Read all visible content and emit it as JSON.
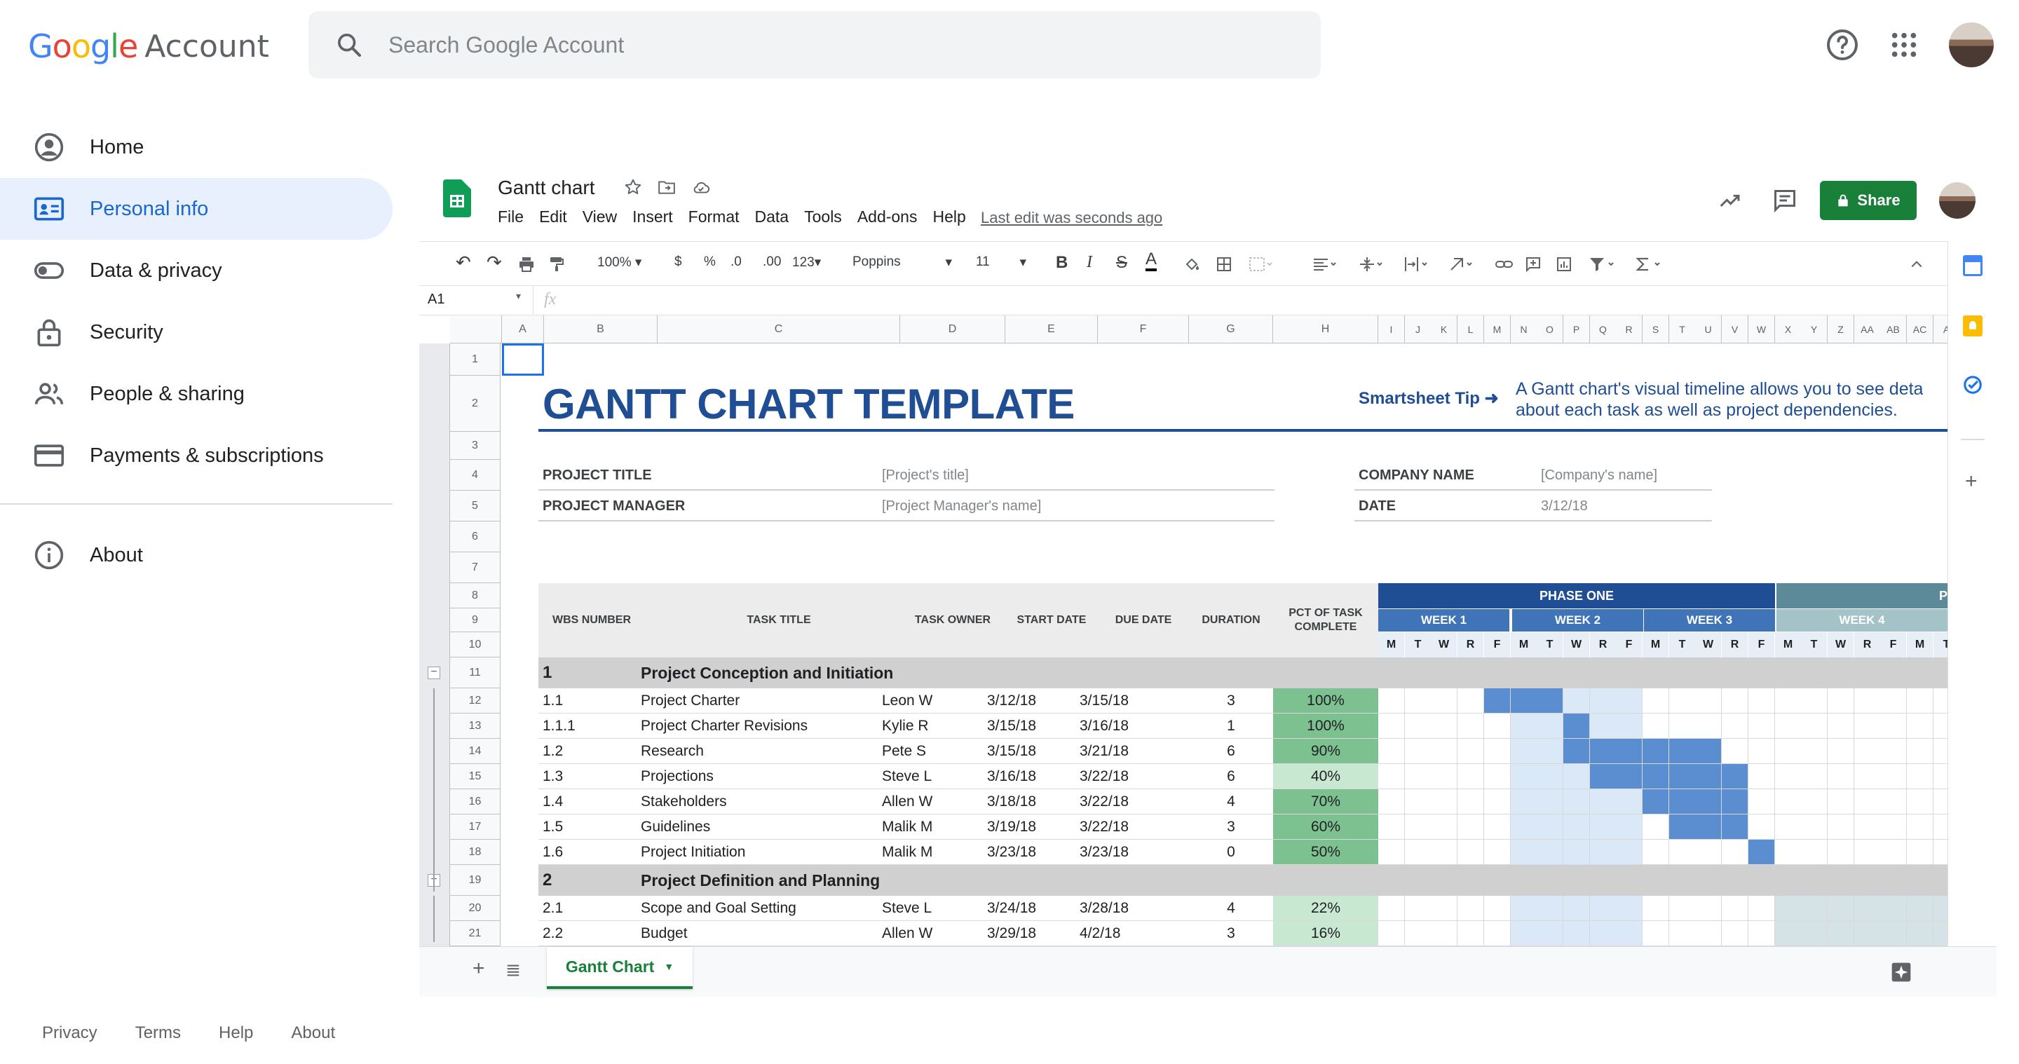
{
  "header": {
    "logo_google": "Google",
    "logo_account": "Account",
    "search_placeholder": "Search Google Account"
  },
  "nav": {
    "items": [
      {
        "label": "Home",
        "icon": "account-circle-icon"
      },
      {
        "label": "Personal info",
        "icon": "id-card-icon",
        "active": true
      },
      {
        "label": "Data & privacy",
        "icon": "toggle-icon"
      },
      {
        "label": "Security",
        "icon": "lock-icon"
      },
      {
        "label": "People & sharing",
        "icon": "people-icon"
      },
      {
        "label": "Payments & subscriptions",
        "icon": "credit-card-icon"
      }
    ],
    "about": "About"
  },
  "footer": {
    "links": [
      "Privacy",
      "Terms",
      "Help",
      "About"
    ]
  },
  "sheet": {
    "title": "Gantt chart",
    "menus": [
      "File",
      "Edit",
      "View",
      "Insert",
      "Format",
      "Data",
      "Tools",
      "Add-ons",
      "Help"
    ],
    "last_edit": "Last edit was seconds ago",
    "share": "Share",
    "toolbar": {
      "zoom": "100%",
      "currency": "$",
      "percent": "%",
      "dec_less": ".0",
      "dec_more": ".00",
      "format": "123",
      "font": "Poppins",
      "size": "11"
    },
    "cell_ref": "A1",
    "fx": "fx",
    "tab": "Gantt Chart",
    "columns": [
      "A",
      "B",
      "C",
      "D",
      "E",
      "F",
      "G",
      "H",
      "I",
      "J",
      "K",
      "L",
      "M",
      "N",
      "O",
      "P",
      "Q",
      "R",
      "S",
      "T",
      "U",
      "V",
      "W",
      "X",
      "Y",
      "Z",
      "AA",
      "AB",
      "AC",
      "A"
    ],
    "rows": [
      "1",
      "2",
      "3",
      "4",
      "5",
      "6",
      "7",
      "8",
      "9",
      "10",
      "11",
      "12",
      "13",
      "14",
      "15",
      "16",
      "17",
      "18",
      "19",
      "20",
      "21"
    ],
    "template_title": "GANTT CHART TEMPLATE",
    "tip_label": "Smartsheet Tip ➜",
    "tip_line1": "A Gantt chart's visual timeline allows you to see deta",
    "tip_line2": "about each task as well as project dependencies.",
    "project_title_label": "PROJECT TITLE",
    "project_title_value": "[Project's title]",
    "project_manager_label": "PROJECT MANAGER",
    "project_manager_value": "[Project Manager's name]",
    "company_label": "COMPANY NAME",
    "company_value": "[Company's name]",
    "date_label": "DATE",
    "date_value": "3/12/18",
    "table_headers": {
      "wbs": "WBS NUMBER",
      "task": "TASK TITLE",
      "owner": "TASK OWNER",
      "start": "START DATE",
      "due": "DUE DATE",
      "duration": "DURATION",
      "pct": "PCT OF TASK COMPLETE"
    },
    "phase1": "PHASE ONE",
    "phase2": "P",
    "weeks": [
      "WEEK 1",
      "WEEK 2",
      "WEEK 3",
      "WEEK 4"
    ],
    "days": [
      "M",
      "T",
      "W",
      "R",
      "F",
      "M",
      "T",
      "W",
      "R",
      "F",
      "M",
      "T",
      "W",
      "R",
      "F",
      "M",
      "T",
      "W",
      "R",
      "F",
      "M",
      "T"
    ],
    "tasks": [
      {
        "wbs": "1",
        "title": "Project Conception and Initiation",
        "section": true
      },
      {
        "wbs": "1.1",
        "title": "Project Charter",
        "owner": "Leon W",
        "start": "3/12/18",
        "due": "3/15/18",
        "duration": "3",
        "pct": "100%",
        "pct_val": 100,
        "bar": [
          4,
          7
        ]
      },
      {
        "wbs": "1.1.1",
        "title": "Project Charter Revisions",
        "owner": "Kylie R",
        "start": "3/15/18",
        "due": "3/16/18",
        "duration": "1",
        "pct": "100%",
        "pct_val": 100,
        "bar": [
          7,
          8
        ]
      },
      {
        "wbs": "1.2",
        "title": "Research",
        "owner": "Pete S",
        "start": "3/15/18",
        "due": "3/21/18",
        "duration": "6",
        "pct": "90%",
        "pct_val": 90,
        "bar": [
          7,
          13
        ]
      },
      {
        "wbs": "1.3",
        "title": "Projections",
        "owner": "Steve L",
        "start": "3/16/18",
        "due": "3/22/18",
        "duration": "6",
        "pct": "40%",
        "pct_val": 40,
        "bar": [
          8,
          14
        ]
      },
      {
        "wbs": "1.4",
        "title": "Stakeholders",
        "owner": "Allen W",
        "start": "3/18/18",
        "due": "3/22/18",
        "duration": "4",
        "pct": "70%",
        "pct_val": 70,
        "bar": [
          10,
          14
        ]
      },
      {
        "wbs": "1.5",
        "title": "Guidelines",
        "owner": "Malik M",
        "start": "3/19/18",
        "due": "3/22/18",
        "duration": "3",
        "pct": "60%",
        "pct_val": 60,
        "bar": [
          11,
          14
        ]
      },
      {
        "wbs": "1.6",
        "title": "Project Initiation",
        "owner": "Malik M",
        "start": "3/23/18",
        "due": "3/23/18",
        "duration": "0",
        "pct": "50%",
        "pct_val": 50,
        "bar": [
          14,
          15
        ]
      },
      {
        "wbs": "2",
        "title": "Project Definition and Planning",
        "section": true
      },
      {
        "wbs": "2.1",
        "title": "Scope and Goal Setting",
        "owner": "Steve L",
        "start": "3/24/18",
        "due": "3/28/18",
        "duration": "4",
        "pct": "22%",
        "pct_val": 22,
        "bar": [
          15,
          19
        ]
      },
      {
        "wbs": "2.2",
        "title": "Budget",
        "owner": "Allen W",
        "start": "3/29/18",
        "due": "4/2/18",
        "duration": "3",
        "pct": "16%",
        "pct_val": 16,
        "bar": [
          19,
          22
        ]
      }
    ]
  },
  "colors": {
    "blue_header": "#1f4e94",
    "week_blue": "#3f74b8",
    "bar_blue": "#5b8ed1",
    "week_light": "#dbe8f7",
    "section_gray": "#d0d0d0",
    "pct_dark": "#7cc18f",
    "pct_light": "#c9e8d2"
  }
}
